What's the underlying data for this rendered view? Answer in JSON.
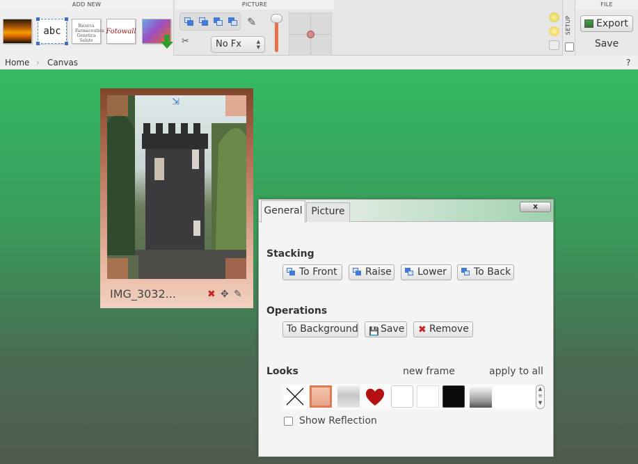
{
  "toolbar": {
    "add_new": {
      "title": "ADD NEW",
      "text_sample": "abc",
      "wordart_sample": "Ricerca Farmaceutica Genetica Salute",
      "fotowall_sample": "Fotowall"
    },
    "picture": {
      "title": "PICTURE",
      "effect_select": "No Fx",
      "opacity_level": 1.0
    },
    "setup": {
      "label": "SETUP"
    },
    "file": {
      "title": "FILE",
      "export_label": "Export",
      "save_label": "Save"
    }
  },
  "breadcrumb": {
    "home": "Home",
    "current": "Canvas",
    "help": "?"
  },
  "canvas": {
    "photo": {
      "title": "IMG_3032..."
    }
  },
  "dialog": {
    "tabs": [
      "General",
      "Picture"
    ],
    "active_tab": "General",
    "close_label": "x",
    "stacking": {
      "heading": "Stacking",
      "buttons": [
        "To Front",
        "Raise",
        "Lower",
        "To Back"
      ]
    },
    "operations": {
      "heading": "Operations",
      "background_label": "To Background",
      "save_label": "Save",
      "remove_label": "Remove"
    },
    "looks": {
      "heading": "Looks",
      "new_frame_label": "new frame",
      "apply_all_label": "apply to all",
      "frames": [
        "none",
        "peach",
        "gray-gradient",
        "heart",
        "white",
        "plain-white",
        "black",
        "silver",
        "blank"
      ],
      "selected_frame": "peach",
      "show_reflection_label": "Show Reflection",
      "show_reflection": false
    }
  },
  "colors": {
    "accent": "#e8734a",
    "canvas_top": "#2fbe63",
    "canvas_bottom": "#4f5b4f",
    "frame_selected": "#e07a50"
  }
}
